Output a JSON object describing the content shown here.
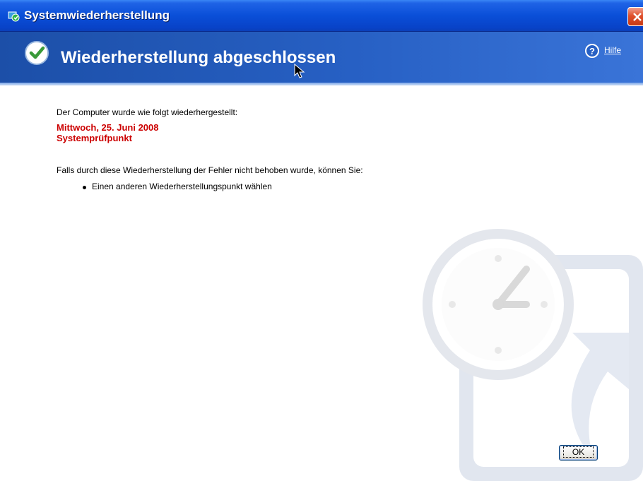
{
  "window": {
    "title": "Systemwiederherstellung",
    "close_icon": "close-icon"
  },
  "header": {
    "title": "Wiederherstellung abgeschlossen",
    "status_icon": "checkmark-icon",
    "help_icon": "help-icon",
    "help_label": "Hilfe"
  },
  "content": {
    "intro": "Der Computer wurde wie folgt wiederhergestellt:",
    "restore_date": "Mittwoch, 25. Juni 2008",
    "restore_point": "Systemprüfpunkt",
    "followup": "Falls durch diese Wiederherstellung der Fehler nicht behoben wurde, können Sie:",
    "options": [
      "Einen anderen Wiederherstellungspunkt wählen"
    ]
  },
  "buttons": {
    "ok_label": "OK"
  },
  "colors": {
    "title_bar": "#0a4fd8",
    "banner": "#2760c4",
    "highlight_text": "#cc0000"
  }
}
